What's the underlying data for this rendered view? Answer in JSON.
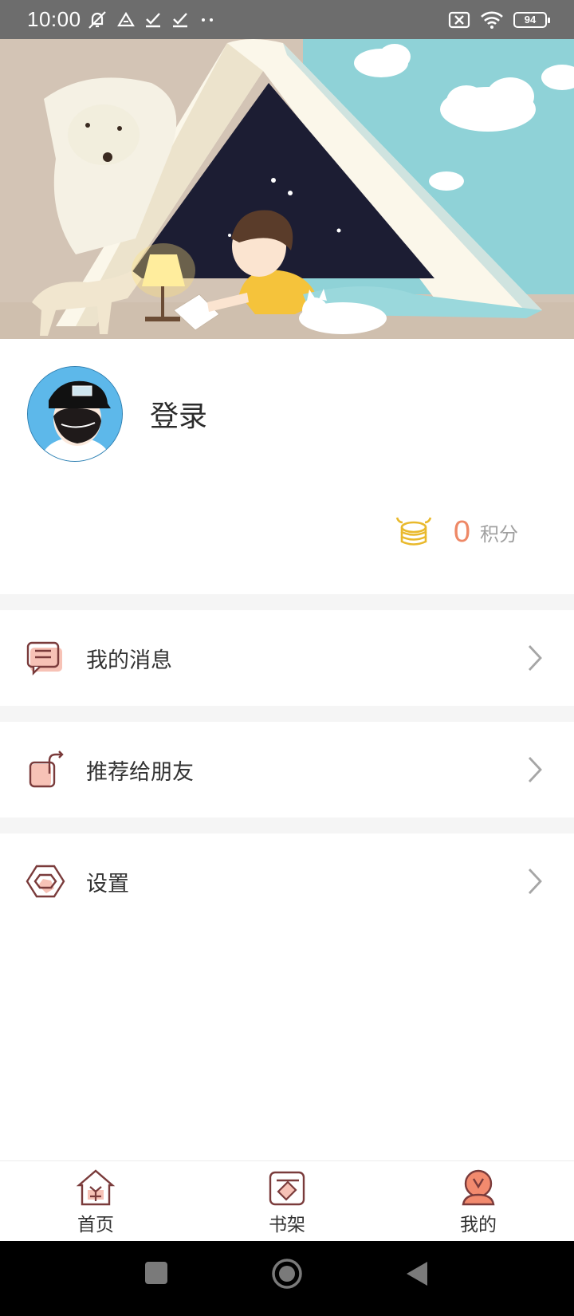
{
  "status_bar": {
    "time": "10:00",
    "battery": "94",
    "icons": [
      "mute-notification-icon",
      "drive-icon",
      "check-icon",
      "check-icon",
      "more-dots-icon",
      "sim-off-icon",
      "wifi-icon",
      "battery-icon"
    ]
  },
  "profile": {
    "login_label": "登录",
    "points_value": "0",
    "points_label": "积分"
  },
  "menu": {
    "items": [
      {
        "label": "我的消息",
        "icon": "message-icon"
      },
      {
        "label": "推荐给朋友",
        "icon": "share-icon"
      },
      {
        "label": "设置",
        "icon": "settings-icon"
      }
    ]
  },
  "tabbar": {
    "tabs": [
      {
        "label": "首页",
        "icon": "home-icon"
      },
      {
        "label": "书架",
        "icon": "bookshelf-icon"
      },
      {
        "label": "我的",
        "icon": "profile-icon",
        "active": true
      }
    ]
  },
  "colors": {
    "accent": "#ee8866",
    "icon_stroke": "#7a3b3b",
    "icon_fill": "#f7c2b6",
    "coin": "#e9b92c",
    "status_bar": "#6d6d6d"
  }
}
